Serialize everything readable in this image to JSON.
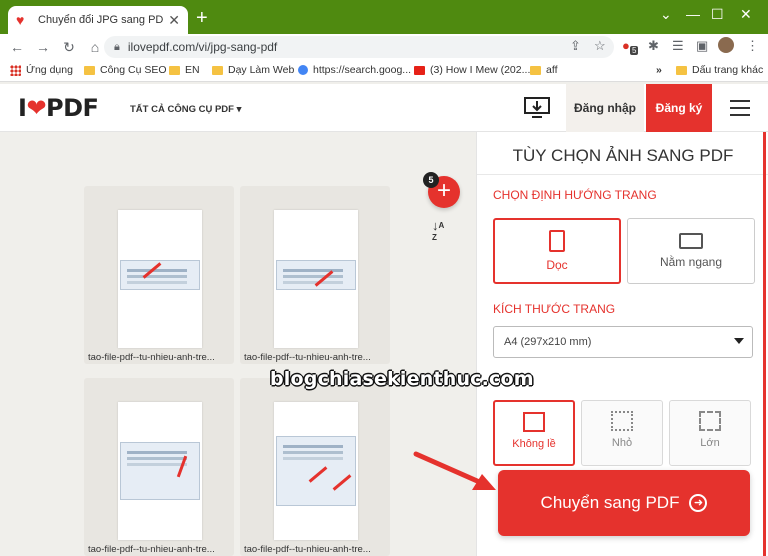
{
  "browser": {
    "tab_title": "Chuyển đổi JPG sang PDF. Chuyể",
    "url": "ilovepdf.com/vi/jpg-sang-pdf",
    "extension_badge": "5"
  },
  "bookmarks": [
    {
      "label": "Ứng dụng",
      "icon": "apps-grid-icon"
    },
    {
      "label": "Công Cụ SEO",
      "icon": "folder-icon"
    },
    {
      "label": "EN",
      "icon": "folder-icon"
    },
    {
      "label": "Dạy Làm Web",
      "icon": "folder-icon"
    },
    {
      "label": "https://search.goog...",
      "icon": "globe-icon"
    },
    {
      "label": "(3) How I Mew (202...",
      "icon": "youtube-icon"
    },
    {
      "label": "aff",
      "icon": "folder-icon"
    },
    {
      "label": "Dấu trang khác",
      "icon": "folder-icon"
    }
  ],
  "header": {
    "logo_left": "I",
    "logo_right": "PDF",
    "all_tools": "TẤT CẢ CÔNG CỤ PDF",
    "login": "Đăng nhập",
    "signup": "Đăng ký"
  },
  "workspace": {
    "file_count": "5",
    "files": [
      {
        "name": "tao-file-pdf--tu-nhieu-anh-tre..."
      },
      {
        "name": "tao-file-pdf--tu-nhieu-anh-tre..."
      },
      {
        "name": "tao-file-pdf--tu-nhieu-anh-tre..."
      },
      {
        "name": "tao-file-pdf--tu-nhieu-anh-tre..."
      }
    ]
  },
  "sidebar": {
    "title": "TÙY CHỌN ẢNH SANG PDF",
    "orientation_label": "CHỌN ĐỊNH HƯỚNG TRANG",
    "portrait": "Dọc",
    "landscape": "Nằm ngang",
    "page_size_label": "KÍCH THƯỚC TRANG",
    "page_size_value": "A4 (297x210 mm)",
    "margins": [
      {
        "label": "Không lề",
        "selected": true
      },
      {
        "label": "Nhỏ",
        "selected": false
      },
      {
        "label": "Lớn",
        "selected": false
      }
    ],
    "convert_button": "Chuyển sang PDF"
  },
  "watermark": "blogchiasekienthuc.com",
  "colors": {
    "accent": "#e5322d",
    "chrome": "#4f8a10"
  }
}
